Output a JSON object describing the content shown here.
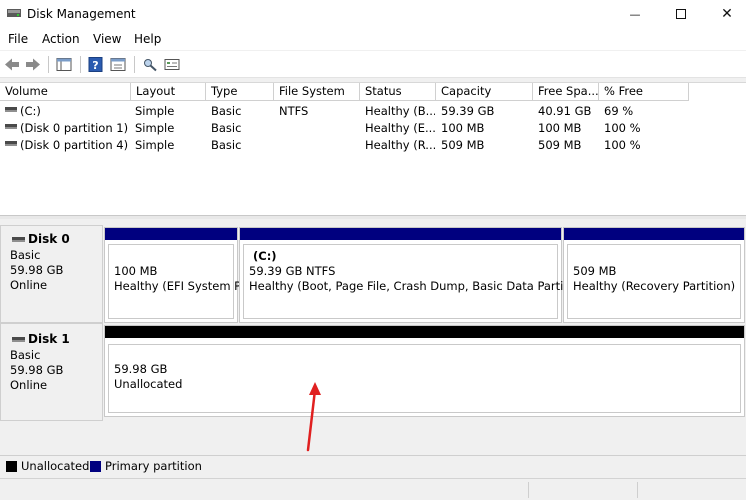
{
  "window": {
    "title": "Disk Management",
    "minimize_glyph": "—",
    "close_glyph": "✕"
  },
  "menu": [
    "File",
    "Action",
    "View",
    "Help"
  ],
  "toolbar": {
    "icons": [
      "back-icon",
      "forward-icon",
      "console-tree-icon",
      "help-icon",
      "properties-icon",
      "rescan-icon",
      "settings-icon"
    ]
  },
  "volume_list": {
    "columns": [
      "Volume",
      "Layout",
      "Type",
      "File System",
      "Status",
      "Capacity",
      "Free Spa...",
      "% Free"
    ],
    "rows": [
      [
        "(C:)",
        "Simple",
        "Basic",
        "NTFS",
        "Healthy (B...",
        "59.39 GB",
        "40.91 GB",
        "69 %"
      ],
      [
        "(Disk 0 partition 1)",
        "Simple",
        "Basic",
        "",
        "Healthy (E...",
        "100 MB",
        "100 MB",
        "100 %"
      ],
      [
        "(Disk 0 partition 4)",
        "Simple",
        "Basic",
        "",
        "Healthy (R...",
        "509 MB",
        "509 MB",
        "100 %"
      ]
    ]
  },
  "disks": [
    {
      "name": "Disk 0",
      "type": "Basic",
      "size": "59.98 GB",
      "status": "Online",
      "partitions": [
        {
          "label": "",
          "size": "100 MB",
          "status": "Healthy (EFI System Pa"
        },
        {
          "label": "(C:)",
          "size": "59.39 GB NTFS",
          "status": "Healthy (Boot, Page File, Crash Dump, Basic Data Partition"
        },
        {
          "label": "",
          "size": "509 MB",
          "status": "Healthy (Recovery Partition)"
        }
      ]
    },
    {
      "name": "Disk 1",
      "type": "Basic",
      "size": "59.98 GB",
      "status": "Online",
      "partitions": [
        {
          "label": "",
          "size": "59.98 GB",
          "status": "Unallocated"
        }
      ]
    }
  ],
  "legend": [
    {
      "label": "Unallocated",
      "color": "#000000"
    },
    {
      "label": "Primary partition",
      "color": "#00007f"
    }
  ],
  "colors": {
    "primary_partition": "#00007f",
    "unallocated": "#000000",
    "annotation_arrow": "#e02020"
  }
}
